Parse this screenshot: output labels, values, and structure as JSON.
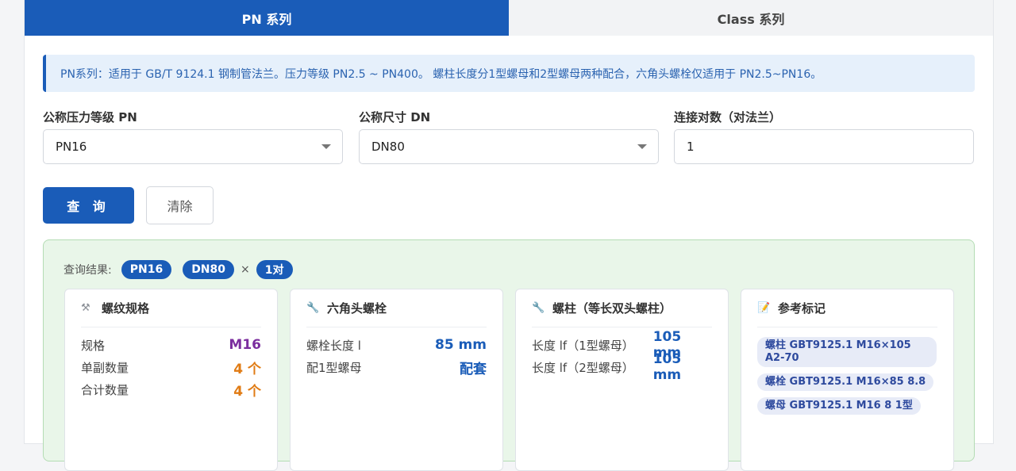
{
  "tabs": [
    {
      "label": "PN 系列",
      "active": true
    },
    {
      "label": "Class 系列",
      "active": false
    }
  ],
  "notice": "PN系列：适用于 GB/T 9124.1 钢制管法兰。压力等级 PN2.5 ~ PN400。 螺柱长度分1型螺母和2型螺母两种配合，六角头螺栓仅适用于 PN2.5~PN16。",
  "form": {
    "pn_label": "公称压力等级 PN",
    "pn_value": "PN16",
    "dn_label": "公称尺寸 DN",
    "dn_value": "DN80",
    "pairs_label": "连接对数（对法兰）",
    "pairs_value": "1"
  },
  "buttons": {
    "query": "查 询",
    "clear": "清除"
  },
  "result": {
    "prefix": "查询结果:",
    "pn": "PN16",
    "dn": "DN80",
    "times": "×",
    "pairs": "1对"
  },
  "cards": {
    "thread": {
      "icon": "bolt-icon",
      "title": "螺纹规格",
      "spec_label": "规格",
      "spec_value": "M16",
      "unit_label": "单副数量",
      "unit_value": "4 个",
      "total_label": "合计数量",
      "total_value": "4 个"
    },
    "hex": {
      "icon": "wrench-icon",
      "title": "六角头螺栓",
      "length_label": "螺栓长度 l",
      "length_value": "85 mm",
      "nut_label": "配1型螺母",
      "nut_value": "配套"
    },
    "stud": {
      "icon": "wrench-icon",
      "title": "螺柱（等长双头螺柱）",
      "lf1_label": "长度 lf（1型螺母）",
      "lf1_value": "105 mm",
      "lf2_label": "长度 lf（2型螺母）",
      "lf2_value": "105 mm"
    },
    "ref": {
      "icon": "memo-icon",
      "title": "参考标记",
      "tags": [
        "螺柱 GBT9125.1 M16×105 A2-70",
        "螺栓 GBT9125.1 M16×85 8.8",
        "螺母 GBT9125.1 M16 8 1型"
      ]
    }
  },
  "colors": {
    "primary": "#1a5cb8",
    "purple": "#7b2e9e",
    "orange": "#e07b14",
    "result_bg": "#e9f6e9"
  }
}
